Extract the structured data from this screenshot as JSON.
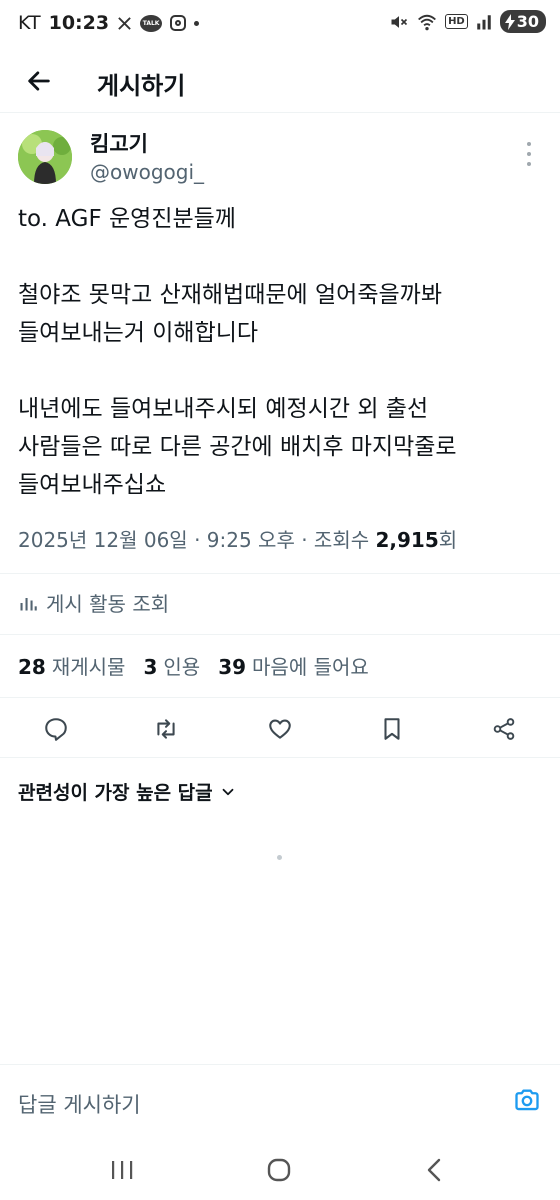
{
  "status_bar": {
    "carrier": "KT",
    "time": "10:23",
    "battery": "30",
    "hd_label": "HD",
    "icons": [
      "x-icon",
      "kakaotalk-icon",
      "instagram-icon",
      "dot-icon",
      "mute-icon",
      "wifi-icon",
      "signal-icon",
      "battery-charging-icon"
    ]
  },
  "header": {
    "title": "게시하기",
    "back_icon": "arrow-left-icon"
  },
  "author": {
    "name": "킴고기",
    "handle": "@owogogi_",
    "more_icon": "more-vertical-icon"
  },
  "tweet": {
    "text": "to. AGF 운영진분들께\n\n철야조 못막고 산재해법때문에 얼어죽을까봐\n들여보내는거 이해합니다\n\n내년에도 들여보내주시되 예정시간 외 출선\n사람들은 따로 다른 공간에 배치후 마지막줄로\n들여보내주십쇼",
    "meta_prefix": "2025년 12월 06일 · 9:25 오후 · 조회수 ",
    "views": "2,915",
    "meta_suffix": "회"
  },
  "activity": {
    "label": "게시 활동 조회",
    "icon": "bar-chart-icon"
  },
  "stats": {
    "reposts_count": "28",
    "reposts_label": "재게시물",
    "quotes_count": "3",
    "quotes_label": "인용",
    "likes_count": "39",
    "likes_label": "마음에 들어요"
  },
  "actions": [
    "reply-icon",
    "repost-icon",
    "like-icon",
    "bookmark-icon",
    "share-icon"
  ],
  "replies": {
    "sort_label": "관련성이 가장 높은 답글",
    "sort_icon": "chevron-down-icon"
  },
  "reply_bar": {
    "placeholder": "답글 게시하기",
    "camera_icon": "camera-icon"
  },
  "nav": [
    "recent-apps-icon",
    "home-icon",
    "back-icon"
  ],
  "colors": {
    "text": "#0f1419",
    "secondary": "#536471",
    "accent": "#1d9bf0",
    "divider": "#eff3f4"
  }
}
